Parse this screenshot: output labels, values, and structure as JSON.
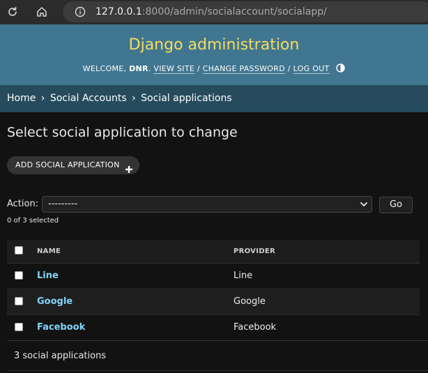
{
  "browser": {
    "url_host": "127.0.0.1",
    "url_rest": ":8000/admin/socialaccount/socialapp/",
    "reload_icon": "reload-icon",
    "home_icon": "home-icon",
    "info_icon": "info-icon"
  },
  "header": {
    "brand": "Django administration",
    "welcome": "WELCOME,",
    "username": "DNR",
    "period": ".",
    "view_site": "VIEW SITE",
    "change_password": "CHANGE PASSWORD",
    "log_out": "LOG OUT",
    "separator": "/",
    "theme_icon": "theme-toggle-icon",
    "brand_color": "#f5dd5d",
    "header_color": "#417690"
  },
  "breadcrumbs": {
    "home": "Home",
    "app": "Social Accounts",
    "current": "Social applications",
    "separator": "›"
  },
  "main": {
    "title": "Select social application to change",
    "add_label": "ADD SOCIAL APPLICATION",
    "action_label": "Action:",
    "action_value": "---------",
    "go_label": "Go",
    "selected_count": "0 of 3 selected",
    "columns": [
      "NAME",
      "PROVIDER"
    ],
    "rows": [
      {
        "name": "Line",
        "provider": "Line"
      },
      {
        "name": "Google",
        "provider": "Google"
      },
      {
        "name": "Facebook",
        "provider": "Facebook"
      }
    ],
    "result_count": "3 social applications",
    "link_color": "#81d4fa"
  }
}
